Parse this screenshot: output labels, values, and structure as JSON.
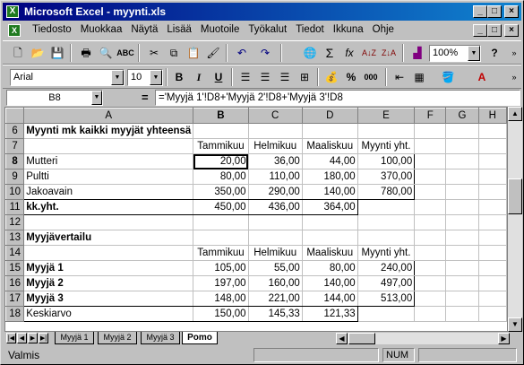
{
  "window": {
    "title": "Microsoft Excel - myynti.xls",
    "controls": [
      "_",
      "□",
      "×"
    ],
    "doc_controls": [
      "_",
      "□",
      "×"
    ]
  },
  "menu": [
    "Tiedosto",
    "Muokkaa",
    "Näytä",
    "Lisää",
    "Muotoile",
    "Työkalut",
    "Tiedot",
    "Ikkuna",
    "Ohje"
  ],
  "toolbar1": {
    "zoom": "100%",
    "help": "?"
  },
  "toolbar2": {
    "font": "Arial",
    "size": "10",
    "bold": "B",
    "italic": "I",
    "underline": "U"
  },
  "formula_bar": {
    "name_box": "B8",
    "equals": "=",
    "formula": "='Myyjä 1'!D8+'Myyjä 2'!D8+'Myyjä 3'!D8"
  },
  "columns": [
    "A",
    "B",
    "C",
    "D",
    "E",
    "F",
    "G",
    "H"
  ],
  "rows": [
    {
      "n": "6",
      "cells": [
        "Myynti mk kaikki myyjät yhteensä",
        "",
        "",
        "",
        "",
        "",
        "",
        ""
      ]
    },
    {
      "n": "7",
      "cells": [
        "",
        "Tammikuu",
        "Helmikuu",
        "Maaliskuu",
        "Myynti yht.",
        "",
        "",
        ""
      ]
    },
    {
      "n": "8",
      "cells": [
        "Mutteri",
        "20,00",
        "36,00",
        "44,00",
        "100,00",
        "",
        "",
        ""
      ]
    },
    {
      "n": "9",
      "cells": [
        "Pultti",
        "80,00",
        "110,00",
        "180,00",
        "370,00",
        "",
        "",
        ""
      ]
    },
    {
      "n": "10",
      "cells": [
        "Jakoavain",
        "350,00",
        "290,00",
        "140,00",
        "780,00",
        "",
        "",
        ""
      ]
    },
    {
      "n": "11",
      "cells": [
        "kk.yht.",
        "450,00",
        "436,00",
        "364,00",
        "",
        "",
        "",
        ""
      ]
    },
    {
      "n": "12",
      "cells": [
        "",
        "",
        "",
        "",
        "",
        "",
        "",
        ""
      ]
    },
    {
      "n": "13",
      "cells": [
        "Myyjävertailu",
        "",
        "",
        "",
        "",
        "",
        "",
        ""
      ]
    },
    {
      "n": "14",
      "cells": [
        "",
        "Tammikuu",
        "Helmikuu",
        "Maaliskuu",
        "Myynti yht.",
        "",
        "",
        ""
      ]
    },
    {
      "n": "15",
      "cells": [
        "Myyjä 1",
        "105,00",
        "55,00",
        "80,00",
        "240,00",
        "",
        "",
        ""
      ]
    },
    {
      "n": "16",
      "cells": [
        "Myyjä 2",
        "197,00",
        "160,00",
        "140,00",
        "497,00",
        "",
        "",
        ""
      ]
    },
    {
      "n": "17",
      "cells": [
        "Myyjä 3",
        "148,00",
        "221,00",
        "144,00",
        "513,00",
        "",
        "",
        ""
      ]
    },
    {
      "n": "18",
      "cells": [
        "Keskiarvo",
        "150,00",
        "145,33",
        "121,33",
        "",
        "",
        "",
        ""
      ]
    }
  ],
  "sheet_tabs": [
    "Myyjä 1",
    "Myyjä 2",
    "Myyjä 3",
    "Pomo"
  ],
  "active_tab": "Pomo",
  "status": {
    "text": "Valmis",
    "num": "NUM"
  }
}
